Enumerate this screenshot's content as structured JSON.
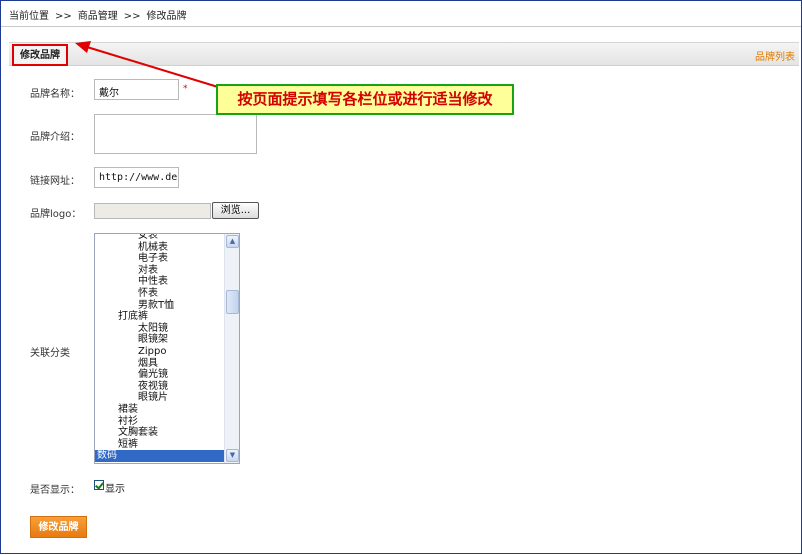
{
  "breadcrumb": {
    "items": [
      "当前位置",
      "商品管理",
      "修改品牌"
    ],
    "separator": ">>"
  },
  "section": {
    "title": "修改品牌",
    "list_link": "品牌列表"
  },
  "form": {
    "name_label": "品牌名称：",
    "name_value": "戴尔",
    "required_mark": "*",
    "intro_label": "品牌介绍：",
    "intro_value": "",
    "url_label": "链接网址：",
    "url_value": "http://www.del",
    "logo_label": "品牌logo：",
    "browse_label": "浏览...",
    "category_label": "关联分类",
    "category_options": [
      {
        "label": "女表",
        "level": 3
      },
      {
        "label": "机械表",
        "level": 3
      },
      {
        "label": "电子表",
        "level": 3
      },
      {
        "label": "对表",
        "level": 3
      },
      {
        "label": "中性表",
        "level": 3
      },
      {
        "label": "怀表",
        "level": 3
      },
      {
        "label": "男款T恤",
        "level": 3
      },
      {
        "label": "打底裤",
        "level": 2
      },
      {
        "label": "太阳镜",
        "level": 3
      },
      {
        "label": "眼镜架",
        "level": 3
      },
      {
        "label": "Zippo",
        "level": 3
      },
      {
        "label": "烟具",
        "level": 3
      },
      {
        "label": "偏光镜",
        "level": 3
      },
      {
        "label": "夜视镜",
        "level": 3
      },
      {
        "label": "眼镜片",
        "level": 3
      },
      {
        "label": "裙装",
        "level": 2
      },
      {
        "label": "衬衫",
        "level": 2
      },
      {
        "label": "文胸套装",
        "level": 2
      },
      {
        "label": "短裤",
        "level": 2
      },
      {
        "label": "数码",
        "level": 1,
        "selected": true
      }
    ],
    "show_label": "是否显示：",
    "show_checkbox_label": "显示",
    "show_checked": true,
    "submit_label": "修改品牌"
  },
  "annotation": {
    "text": "按页面提示填写各栏位或进行适当修改"
  },
  "colors": {
    "accent_orange": "#e87a10",
    "highlight_red": "#e10000",
    "callout_bg": "#ffff99",
    "callout_border": "#17a317",
    "selection_blue": "#3169c6"
  }
}
